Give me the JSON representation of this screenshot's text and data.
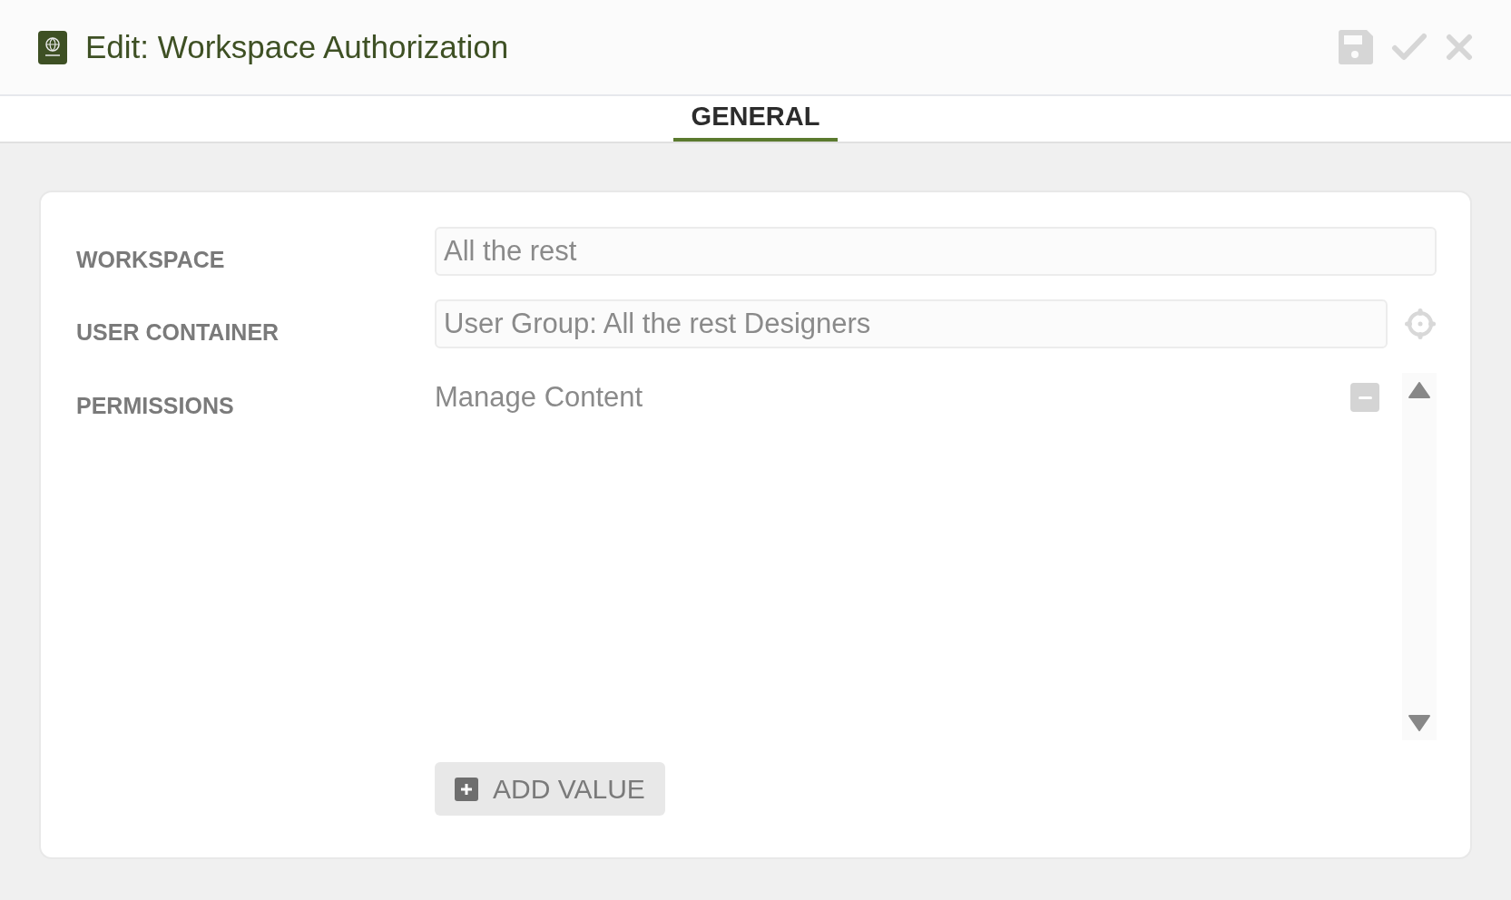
{
  "window": {
    "title": "Edit: Workspace Authorization"
  },
  "tabs": [
    {
      "label": "GENERAL",
      "selected": true
    }
  ],
  "form": {
    "fields": [
      {
        "kind": "text",
        "label": "WORKSPACE",
        "value": "All the rest"
      },
      {
        "kind": "picker",
        "label": "USER CONTAINER",
        "value": "User Group: All the rest Designers"
      },
      {
        "kind": "list",
        "label": "PERMISSIONS",
        "values": [
          "Manage Content"
        ],
        "add_label": "ADD VALUE"
      }
    ]
  }
}
